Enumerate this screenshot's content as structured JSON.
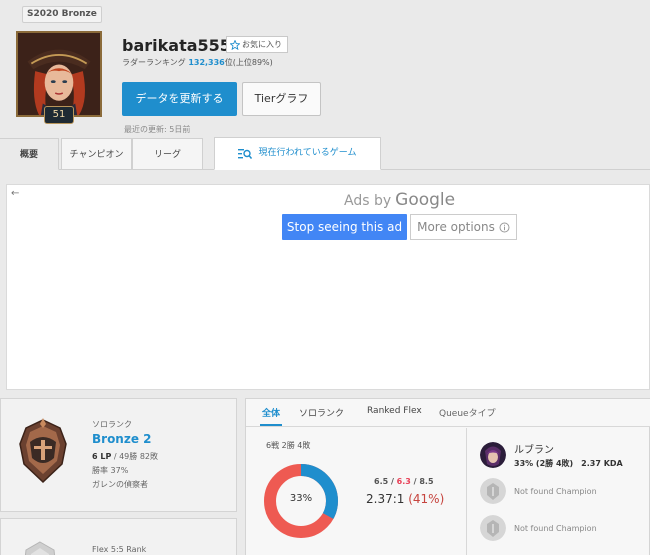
{
  "header": {
    "season_badge": "S2020 Bronze",
    "summoner_name": "barikata555",
    "favorite_label": "お気に入り",
    "ladder_prefix": "ラダーランキング",
    "ladder_rank": "132,336",
    "ladder_suffix": "位(上位89%)",
    "level": "51",
    "refresh_label": "データを更新する",
    "tier_graph_label": "Tierグラフ",
    "last_update": "最近の更新: 5日前"
  },
  "tabs": {
    "overview": "概要",
    "champion": "チャンピオン",
    "league": "リーグ",
    "live_game": "現在行われているゲーム"
  },
  "ad": {
    "back_arrow": "←",
    "ads_by": "Ads by",
    "google": "Google",
    "stop_label": "Stop seeing this ad",
    "more_label": "More options"
  },
  "solo_rank": {
    "queue": "ソロランク",
    "tier": "Bronze 2",
    "lp": "6 LP",
    "record": " / 49勝 82敗",
    "winrate": "勝率 37%",
    "league_name": "ガレンの偵察者"
  },
  "flex_rank": {
    "queue": "Flex 5:5 Rank"
  },
  "stats": {
    "tabs": [
      "全体",
      "ソロランク",
      "Ranked Flex",
      "Queueタイプ"
    ],
    "games_summary": "6戦 2勝 4敗",
    "winrate_label": "33%",
    "win_fraction": 0.33,
    "kills": "6.5",
    "slash1": " / ",
    "deaths": "6.3",
    "slash2": " / ",
    "assists": "8.5",
    "kda_ratio": "2.37:1",
    "kda_pct": "(41%)",
    "colors": {
      "win": "#1f8ecd",
      "loss": "#ee5a52"
    }
  },
  "champions": [
    {
      "name": "ルブラン",
      "record": "33% (2勝 4敗)",
      "kda": "2.37 KDA"
    },
    {
      "name": "Not found Champion"
    },
    {
      "name": "Not found Champion"
    }
  ]
}
